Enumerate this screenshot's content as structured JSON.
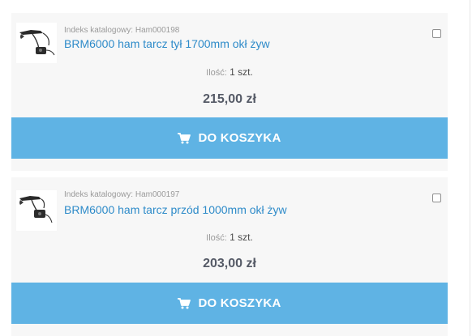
{
  "products": [
    {
      "sku_label": "Indeks katalogowy:",
      "sku": "Ham000198",
      "title": "BRM6000 ham tarcz tył 1700mm okł żyw",
      "qty_label": "Ilość:",
      "qty": "1 szt.",
      "price": "215,00 zł",
      "button_label": "DO KOSZYKA"
    },
    {
      "sku_label": "Indeks katalogowy:",
      "sku": "Ham000197",
      "title": "BRM6000 ham tarcz przód 1000mm okł żyw",
      "qty_label": "Ilość:",
      "qty": "1 szt.",
      "price": "203,00 zł",
      "button_label": "DO KOSZYKA"
    }
  ],
  "icons": {
    "cart": "shopping-cart-icon",
    "checkbox": "compare-checkbox"
  },
  "colors": {
    "button": "#5fb3e4",
    "link": "#2e8bc9",
    "price": "#555a66",
    "card": "#f7f7f7"
  }
}
